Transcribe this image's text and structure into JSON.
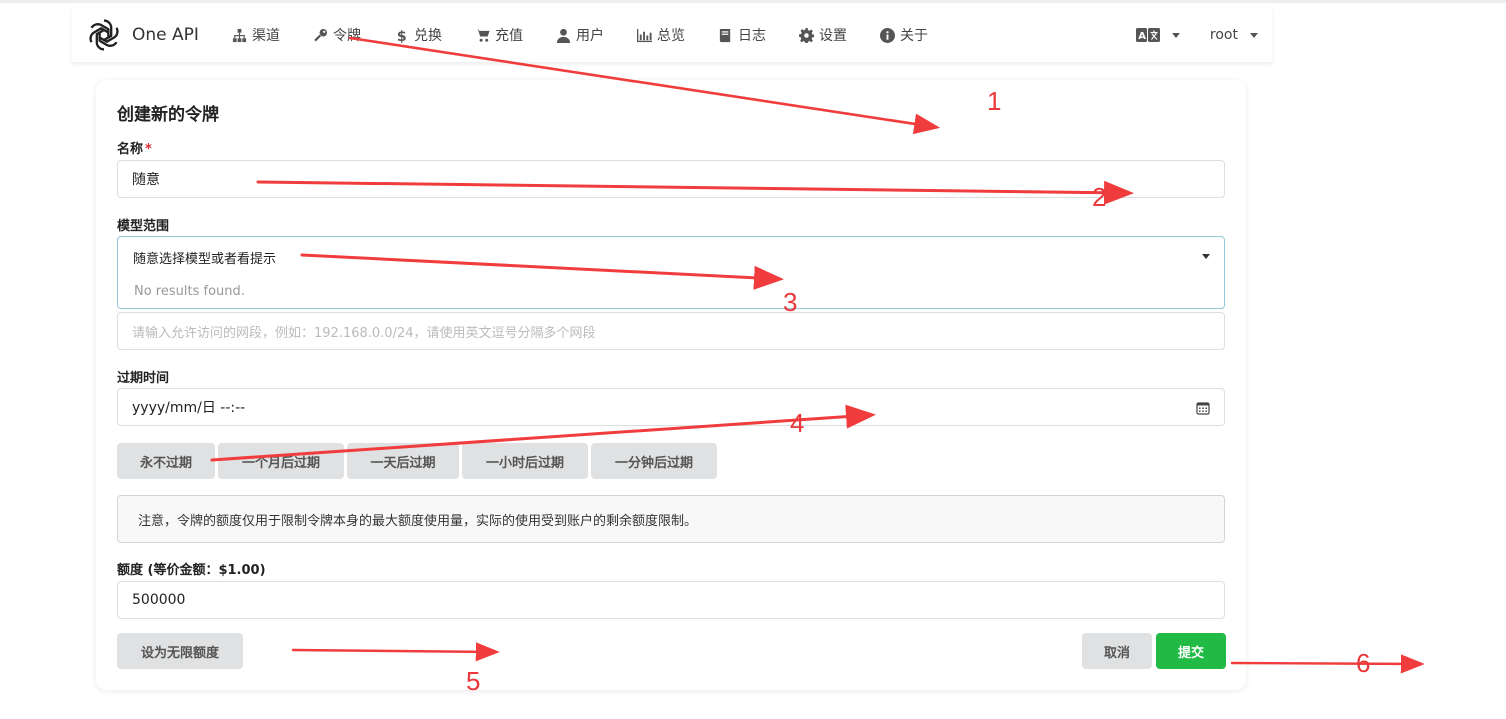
{
  "app": {
    "brand": "One API"
  },
  "nav": {
    "items": [
      {
        "label": "渠道",
        "icon": "sitemap-icon"
      },
      {
        "label": "令牌",
        "icon": "key-icon"
      },
      {
        "label": "兑换",
        "icon": "dollar-icon"
      },
      {
        "label": "充值",
        "icon": "cart-icon"
      },
      {
        "label": "用户",
        "icon": "user-icon"
      },
      {
        "label": "总览",
        "icon": "bar-chart-icon"
      },
      {
        "label": "日志",
        "icon": "book-icon"
      },
      {
        "label": "设置",
        "icon": "gear-icon"
      },
      {
        "label": "关于",
        "icon": "info-icon"
      }
    ],
    "user": "root"
  },
  "form": {
    "title": "创建新的令牌",
    "name_label": "名称",
    "name_required": "*",
    "name_value": "随意",
    "models_label": "模型范围",
    "models_value": "随意选择模型或者看提示",
    "models_empty": "No results found.",
    "subnet_placeholder": "请输入允许访问的网段，例如：192.168.0.0/24，请使用英文逗号分隔多个网段",
    "expire_label": "过期时间",
    "expire_value": "yyyy/mm/日 --:--",
    "expire_buttons": [
      "永不过期",
      "一个月后过期",
      "一天后过期",
      "一小时后过期",
      "一分钟后过期"
    ],
    "notice": "注意，令牌的额度仅用于限制令牌本身的最大额度使用量，实际的使用受到账户的剩余额度限制。",
    "quota_label": "额度 (等价金额：$1.00)",
    "quota_value": "500000",
    "unlimited_button": "设为无限额度",
    "cancel_button": "取消",
    "submit_button": "提交"
  },
  "annotations": {
    "color": "#e8383b",
    "numbers": [
      "1",
      "2",
      "3",
      "4",
      "5",
      "6"
    ]
  }
}
